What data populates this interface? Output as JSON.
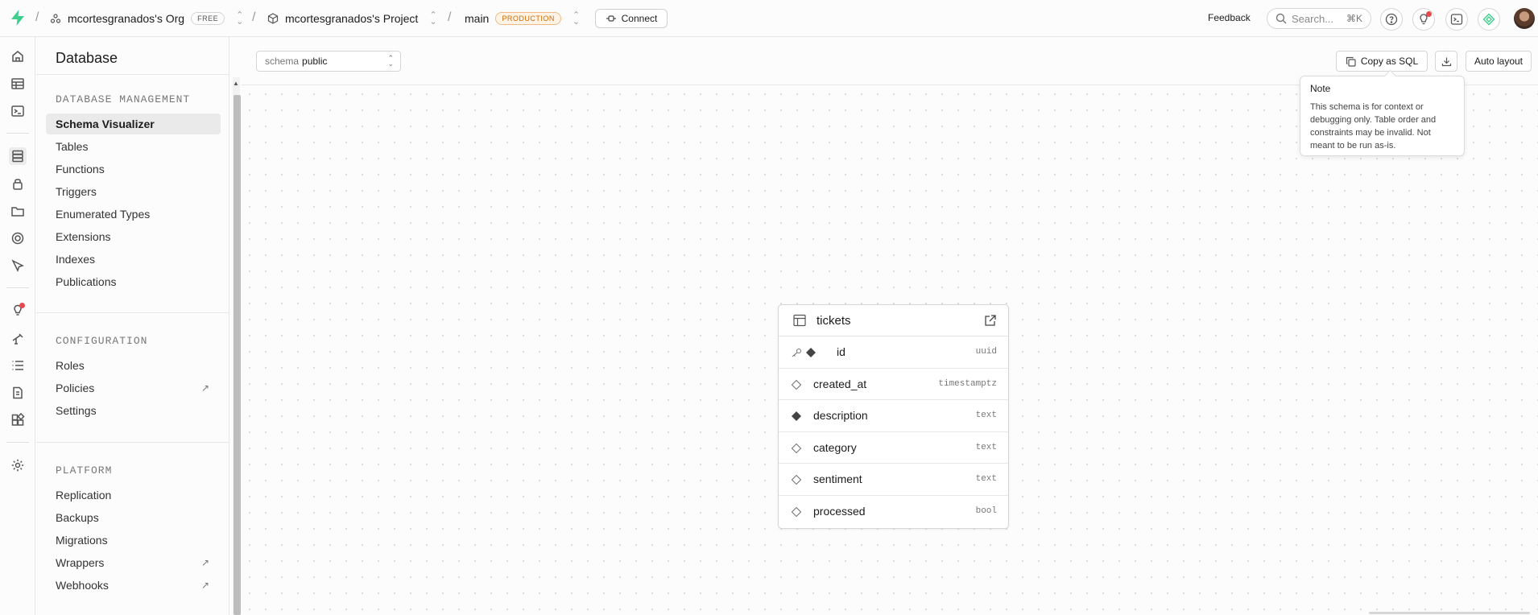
{
  "topbar": {
    "org_name": "mcortesgranados's Org",
    "org_badge": "FREE",
    "project_name": "mcortesgranados's Project",
    "branch": "main",
    "branch_badge": "PRODUCTION",
    "connect_label": "Connect",
    "feedback_label": "Feedback",
    "search_placeholder": "Search...",
    "search_shortcut": "⌘K"
  },
  "sidebar": {
    "title": "Database",
    "sections": [
      {
        "label": "DATABASE MANAGEMENT",
        "items": [
          "Schema Visualizer",
          "Tables",
          "Functions",
          "Triggers",
          "Enumerated Types",
          "Extensions",
          "Indexes",
          "Publications"
        ]
      },
      {
        "label": "CONFIGURATION",
        "items": [
          "Roles",
          "Policies",
          "Settings"
        ]
      },
      {
        "label": "PLATFORM",
        "items": [
          "Replication",
          "Backups",
          "Migrations",
          "Wrappers",
          "Webhooks"
        ]
      }
    ],
    "active_item": "Schema Visualizer"
  },
  "toolbar": {
    "schema_label": "schema",
    "schema_value": "public",
    "copy_sql_label": "Copy as SQL",
    "auto_layout_label": "Auto layout"
  },
  "tooltip": {
    "title": "Note",
    "body": "This schema is for context or debugging only. Table order and constraints may be invalid. Not meant to be run as-is."
  },
  "table": {
    "name": "tickets",
    "columns": [
      {
        "name": "id",
        "type": "uuid",
        "primary_key": true,
        "required": true
      },
      {
        "name": "created_at",
        "type": "timestamptz",
        "primary_key": false,
        "required": false
      },
      {
        "name": "description",
        "type": "text",
        "primary_key": false,
        "required": true
      },
      {
        "name": "category",
        "type": "text",
        "primary_key": false,
        "required": false
      },
      {
        "name": "sentiment",
        "type": "text",
        "primary_key": false,
        "required": false
      },
      {
        "name": "processed",
        "type": "bool",
        "primary_key": false,
        "required": false
      }
    ]
  },
  "colors": {
    "brand": "#3ecf8e",
    "production_badge": "#d26a00",
    "notification_dot": "#e5484d"
  },
  "icons": {
    "rail": [
      "home-icon",
      "table-editor-icon",
      "sql-editor-icon",
      "database-icon",
      "auth-icon",
      "storage-icon",
      "edge-functions-icon",
      "realtime-icon",
      "advisors-icon",
      "reports-icon",
      "logs-icon",
      "api-docs-icon",
      "integrations-icon",
      "settings-icon"
    ]
  }
}
